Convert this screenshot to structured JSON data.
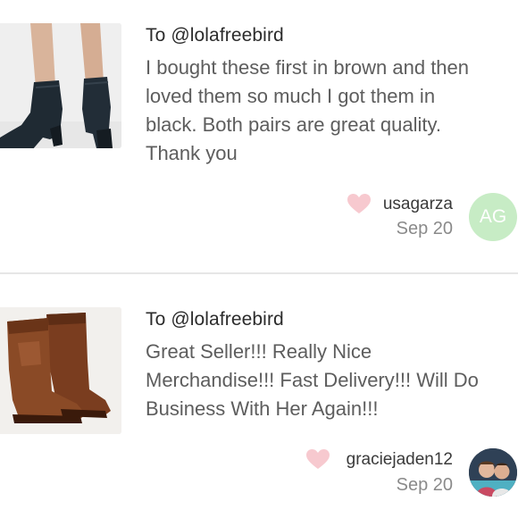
{
  "reviews": [
    {
      "to_line": "To @lolafreebird",
      "text_lines": [
        "I bought these first in brown and then",
        "loved them so much I got them in",
        "black. Both pairs are great quality.",
        "Thank you"
      ],
      "username": "usagarza",
      "date": "Sep 20",
      "avatar_initials": "AG",
      "avatar_color": "#c7ecc5",
      "product_image": "black-ankle-boots-image"
    },
    {
      "to_line": "To @lolafreebird",
      "text_lines": [
        "Great Seller!!! Really Nice",
        "Merchandise!!! Fast Delivery!!! Will Do",
        "Business With Her Again!!!"
      ],
      "username": "graciejaden12",
      "date": "Sep 20",
      "avatar_initials": "",
      "avatar_color": "#2d3b4a",
      "product_image": "brown-cowboy-boots-image"
    }
  ],
  "icons": {
    "like": "heart-icon"
  },
  "colors": {
    "heart": "#f7c9cf",
    "divider": "#e6e6e6"
  }
}
